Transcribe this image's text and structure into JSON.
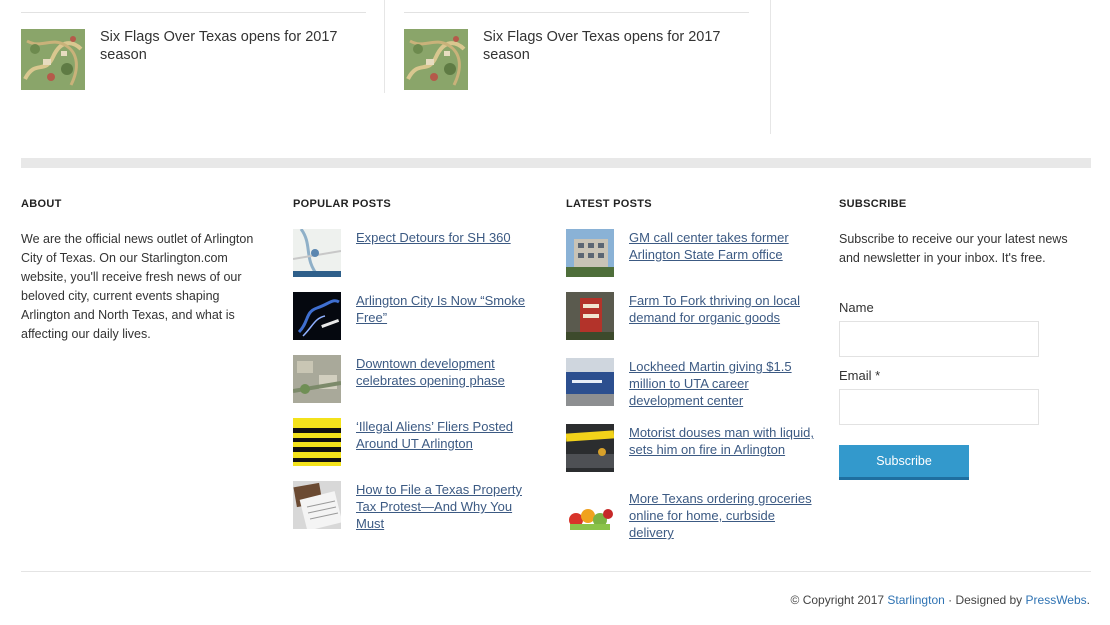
{
  "related": [
    {
      "title": "Six Flags Over Texas opens for 2017 season",
      "thumb": "park-map"
    },
    {
      "title": "Six Flags Over Texas opens for 2017 season",
      "thumb": "park-map"
    }
  ],
  "about": {
    "heading": "ABOUT",
    "text": "We are the official news outlet of Arlington City of Texas. On our Starlington.com website, you'll receive fresh news of our beloved city, current events shaping Arlington and North Texas, and what is affecting our daily lives."
  },
  "popular": {
    "heading": "POPULAR POSTS",
    "items": [
      {
        "title": "Expect Detours for SH 360",
        "thumb": "road-map"
      },
      {
        "title": "Arlington City Is Now “Smoke Free”",
        "thumb": "smoke"
      },
      {
        "title": "Downtown development celebrates opening phase",
        "thumb": "aerial-site"
      },
      {
        "title": "‘Illegal Aliens’ Fliers Posted Around UT Arlington",
        "thumb": "notice-flier"
      },
      {
        "title": "How to File a Texas Property Tax Protest—And Why You Must",
        "thumb": "tax-form"
      }
    ]
  },
  "latest": {
    "heading": "LATEST POSTS",
    "items": [
      {
        "title": "GM call center takes former Arlington State Farm office",
        "thumb": "office-building"
      },
      {
        "title": "Farm To Fork thriving on local demand for organic goods",
        "thumb": "farm-sign"
      },
      {
        "title": "Lockheed Martin giving $1.5 million to UTA career development center",
        "thumb": "blue-sign"
      },
      {
        "title": "Motorist douses man with liquid, sets him on fire in Arlington",
        "thumb": "police-tape"
      },
      {
        "title": "More Texans ordering groceries online for home, curbside delivery",
        "thumb": "groceries"
      }
    ]
  },
  "subscribe": {
    "heading": "SUBSCRIBE",
    "text": "Subscribe to receive our your latest news and newsletter in your inbox. It's free.",
    "name_label": "Name",
    "email_label": "Email *",
    "button_label": "Subscribe"
  },
  "footer": {
    "copyright_prefix": "© Copyright 2017 ",
    "site_name": "Starlington",
    "designed_by": " · Designed by ",
    "designer": "PressWebs",
    "suffix": "."
  },
  "colors": {
    "link": "#3c5a83",
    "button": "#3399cc",
    "band": "#e8e8e8"
  }
}
